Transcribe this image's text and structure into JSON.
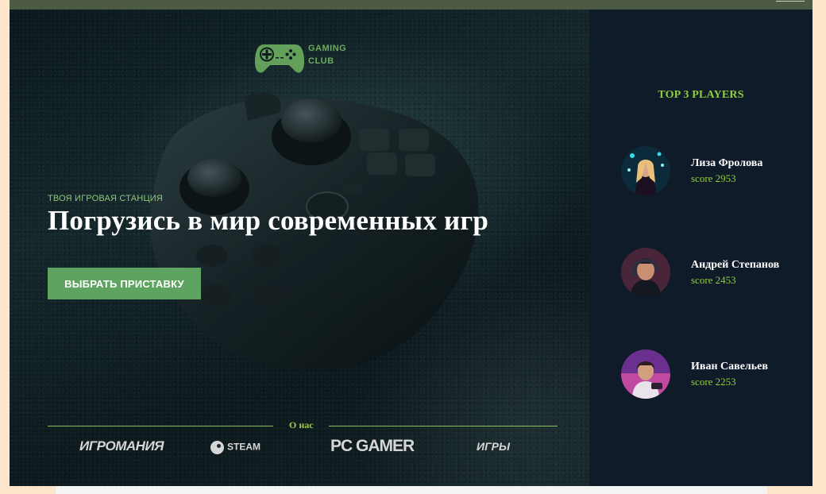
{
  "logo": {
    "line1": "GAMING",
    "line2": "CLUB"
  },
  "hero": {
    "eyebrow": "ТВОЯ ИГРОВАЯ СТАНЦИЯ",
    "headline": "Погрузись в мир современных игр",
    "cta": "ВЫБРАТЬ ПРИСТАВКУ"
  },
  "about": {
    "label": "О нас"
  },
  "partners": [
    "ИГРОМАНИЯ",
    "STEAM",
    "PC GAMER",
    "ИГРЫ"
  ],
  "sidebar": {
    "title": "TOP 3 PLAYERS",
    "players": [
      {
        "name": "Лиза Фролова",
        "score": "score 2953"
      },
      {
        "name": "Андрей Степанов",
        "score": "score 2453"
      },
      {
        "name": "Иван Савельев",
        "score": "score 2253"
      }
    ]
  },
  "colors": {
    "accent": "#8ecf3f",
    "button": "#5ea360",
    "sidebar": "#101b29",
    "page": "#fde6cc"
  }
}
